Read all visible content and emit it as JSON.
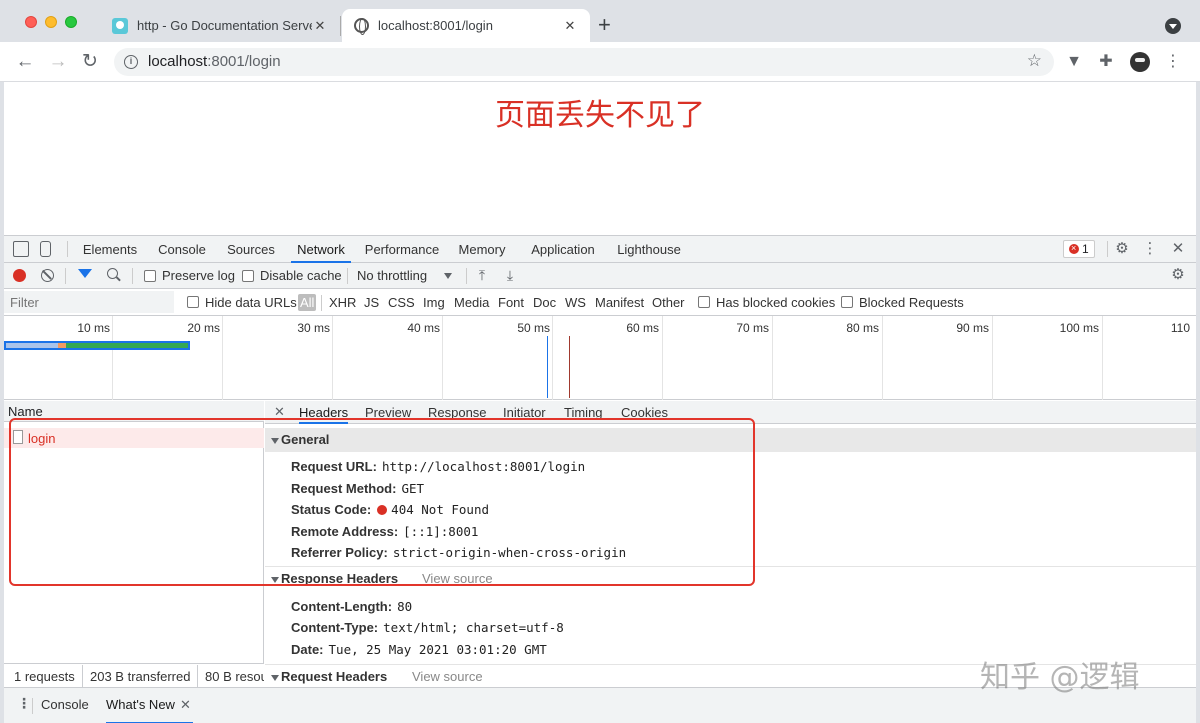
{
  "browser": {
    "tabs": [
      {
        "title": "http - Go Documentation Serve",
        "favicon": "go-gopher-icon",
        "active": false
      },
      {
        "title": "localhost:8001/login",
        "favicon": "globe-icon",
        "active": true
      }
    ],
    "new_tab_label": "+",
    "address": {
      "host": "localhost",
      "path": ":8001/login"
    }
  },
  "page": {
    "message": "页面丢失不见了",
    "message_color": "#d93025"
  },
  "devtools": {
    "panels": [
      "Elements",
      "Console",
      "Sources",
      "Network",
      "Performance",
      "Memory",
      "Application",
      "Lighthouse"
    ],
    "active_panel": "Network",
    "error_count": "1",
    "toolbar": {
      "preserve_log": "Preserve log",
      "disable_cache": "Disable cache",
      "throttling": "No throttling"
    },
    "filter": {
      "placeholder": "Filter",
      "hide_data_urls": "Hide data URLs",
      "types": [
        "All",
        "XHR",
        "JS",
        "CSS",
        "Img",
        "Media",
        "Font",
        "Doc",
        "WS",
        "Manifest",
        "Other"
      ],
      "has_blocked_cookies": "Has blocked cookies",
      "blocked_requests": "Blocked Requests"
    },
    "timeline_ticks": [
      "10 ms",
      "20 ms",
      "30 ms",
      "40 ms",
      "50 ms",
      "60 ms",
      "70 ms",
      "80 ms",
      "90 ms",
      "100 ms",
      "110"
    ],
    "request_list": {
      "header": "Name",
      "rows": [
        {
          "name": "login"
        }
      ],
      "summary": {
        "requests": "1 requests",
        "transferred": "203 B transferred",
        "resources": "80 B resou"
      }
    },
    "details": {
      "tabs": [
        "Headers",
        "Preview",
        "Response",
        "Initiator",
        "Timing",
        "Cookies"
      ],
      "active_tab": "Headers",
      "general": {
        "title": "General",
        "request_url": {
          "k": "Request URL:",
          "v": "http://localhost:8001/login"
        },
        "request_method": {
          "k": "Request Method:",
          "v": "GET"
        },
        "status_code": {
          "k": "Status Code:",
          "v": "404 Not Found"
        },
        "remote_address": {
          "k": "Remote Address:",
          "v": "[::1]:8001"
        },
        "referrer_policy": {
          "k": "Referrer Policy:",
          "v": "strict-origin-when-cross-origin"
        }
      },
      "response_headers": {
        "title": "Response Headers",
        "view_source": "View source",
        "content_length": {
          "k": "Content-Length:",
          "v": "80"
        },
        "content_type": {
          "k": "Content-Type:",
          "v": "text/html; charset=utf-8"
        },
        "date": {
          "k": "Date:",
          "v": "Tue, 25 May 2021 03:01:20 GMT"
        }
      },
      "request_headers": {
        "title": "Request Headers",
        "view_source": "View source"
      }
    },
    "drawer": {
      "tabs": [
        "Console",
        "What's New"
      ],
      "active_tab": "What's New"
    }
  },
  "watermark": "知乎 @逻辑",
  "colors": {
    "accent": "#1a73e8",
    "error": "#d93025",
    "annotation": "#e2352b"
  }
}
